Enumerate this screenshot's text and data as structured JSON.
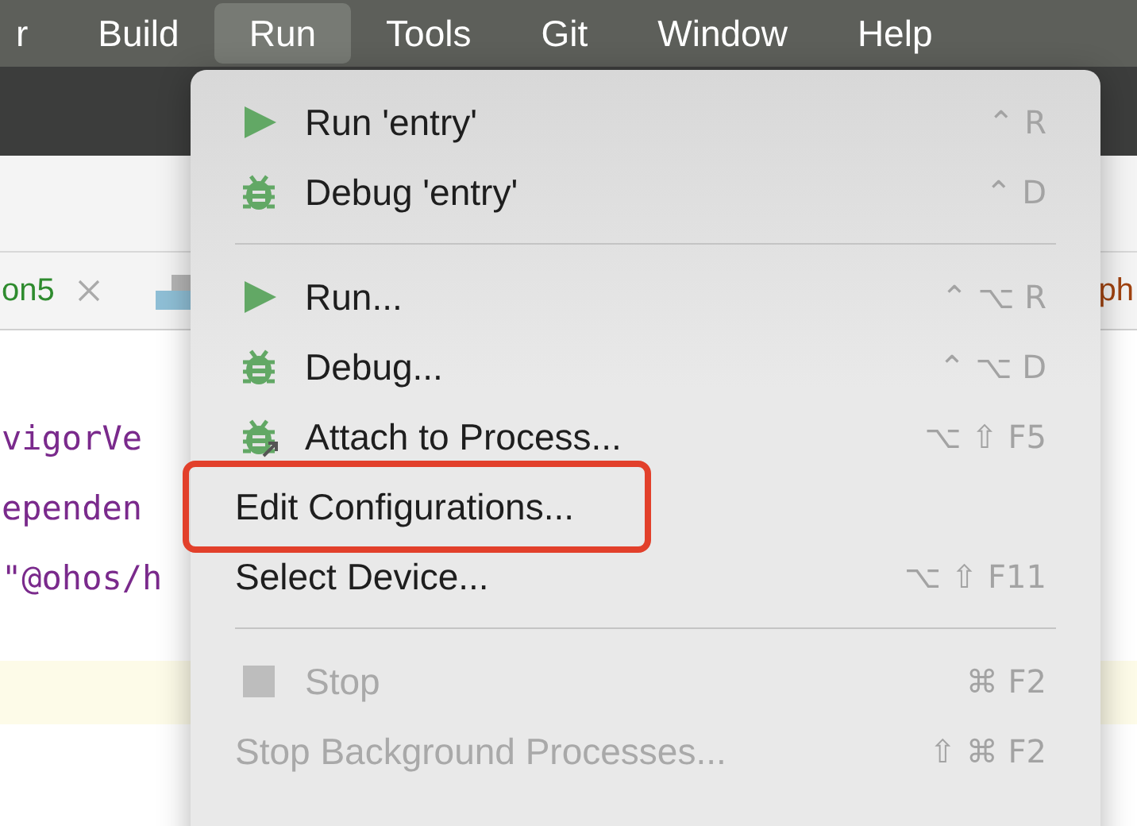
{
  "menubar": [
    {
      "label": "r",
      "selected": false
    },
    {
      "label": "Build",
      "selected": false
    },
    {
      "label": "Run",
      "selected": true
    },
    {
      "label": "Tools",
      "selected": false
    },
    {
      "label": "Git",
      "selected": false
    },
    {
      "label": "Window",
      "selected": false
    },
    {
      "label": "Help",
      "selected": false
    }
  ],
  "editor_tab": {
    "label": "on5",
    "next_label": "ph"
  },
  "code_lines": [
    "vigorVe",
    "ependen",
    "\"@ohos/h"
  ],
  "menu": [
    {
      "kind": "play",
      "label": "Run 'entry'",
      "shortcut": "⌃ R",
      "disabled": false,
      "highlighted": false
    },
    {
      "kind": "bug",
      "label": "Debug 'entry'",
      "shortcut": "⌃ D",
      "disabled": false,
      "highlighted": false
    },
    {
      "kind": "separator"
    },
    {
      "kind": "play",
      "label": "Run...",
      "shortcut": "⌃ ⌥ R",
      "disabled": false,
      "highlighted": false
    },
    {
      "kind": "bug",
      "label": "Debug...",
      "shortcut": "⌃ ⌥ D",
      "disabled": false,
      "highlighted": false
    },
    {
      "kind": "attach",
      "label": "Attach to Process...",
      "shortcut": "⌥ ⇧ F5",
      "disabled": false,
      "highlighted": false
    },
    {
      "kind": "plain",
      "label": "Edit Configurations...",
      "disabled": false,
      "highlighted": true
    },
    {
      "kind": "plain",
      "label": "Select Device...",
      "shortcut": "⌥ ⇧ F11",
      "disabled": false,
      "highlighted": false
    },
    {
      "kind": "separator"
    },
    {
      "kind": "stop",
      "label": "Stop",
      "shortcut": "⌘ F2",
      "disabled": true,
      "highlighted": false
    },
    {
      "kind": "plain",
      "label": "Stop Background Processes...",
      "shortcut": "⇧ ⌘ F2",
      "disabled": true,
      "highlighted": false
    }
  ]
}
